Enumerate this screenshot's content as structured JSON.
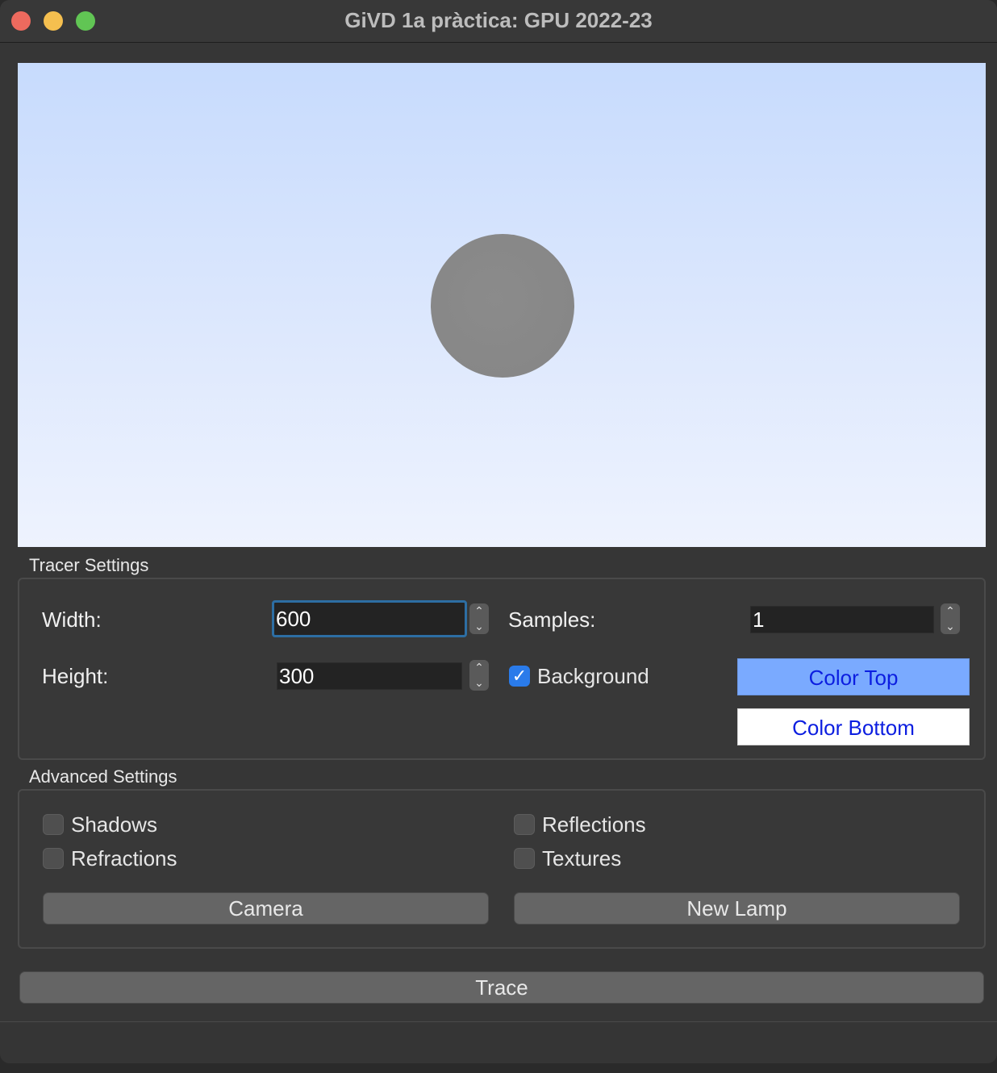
{
  "window": {
    "title": "GiVD 1a pràctica: GPU 2022-23"
  },
  "viewport": {
    "background_top_color": "#c7dbfd",
    "background_bottom_color": "#eef3fe",
    "sphere_color": "#888888"
  },
  "tracer_settings": {
    "group_label": "Tracer Settings",
    "width_label": "Width:",
    "width_value": "600",
    "height_label": "Height:",
    "height_value": "300",
    "samples_label": "Samples:",
    "samples_value": "1",
    "background_label": "Background",
    "background_checked": true,
    "color_top_label": "Color Top",
    "color_top_swatch": "#7aaaff",
    "color_bottom_label": "Color Bottom",
    "color_bottom_swatch": "#ffffff"
  },
  "advanced_settings": {
    "group_label": "Advanced Settings",
    "shadows_label": "Shadows",
    "refractions_label": "Refractions",
    "reflections_label": "Reflections",
    "textures_label": "Textures",
    "camera_label": "Camera",
    "new_lamp_label": "New Lamp"
  },
  "trace_label": "Trace",
  "icons": {
    "stepper_up": "chevron-up-icon",
    "stepper_down": "chevron-down-icon",
    "checkmark": "checkmark-icon"
  }
}
